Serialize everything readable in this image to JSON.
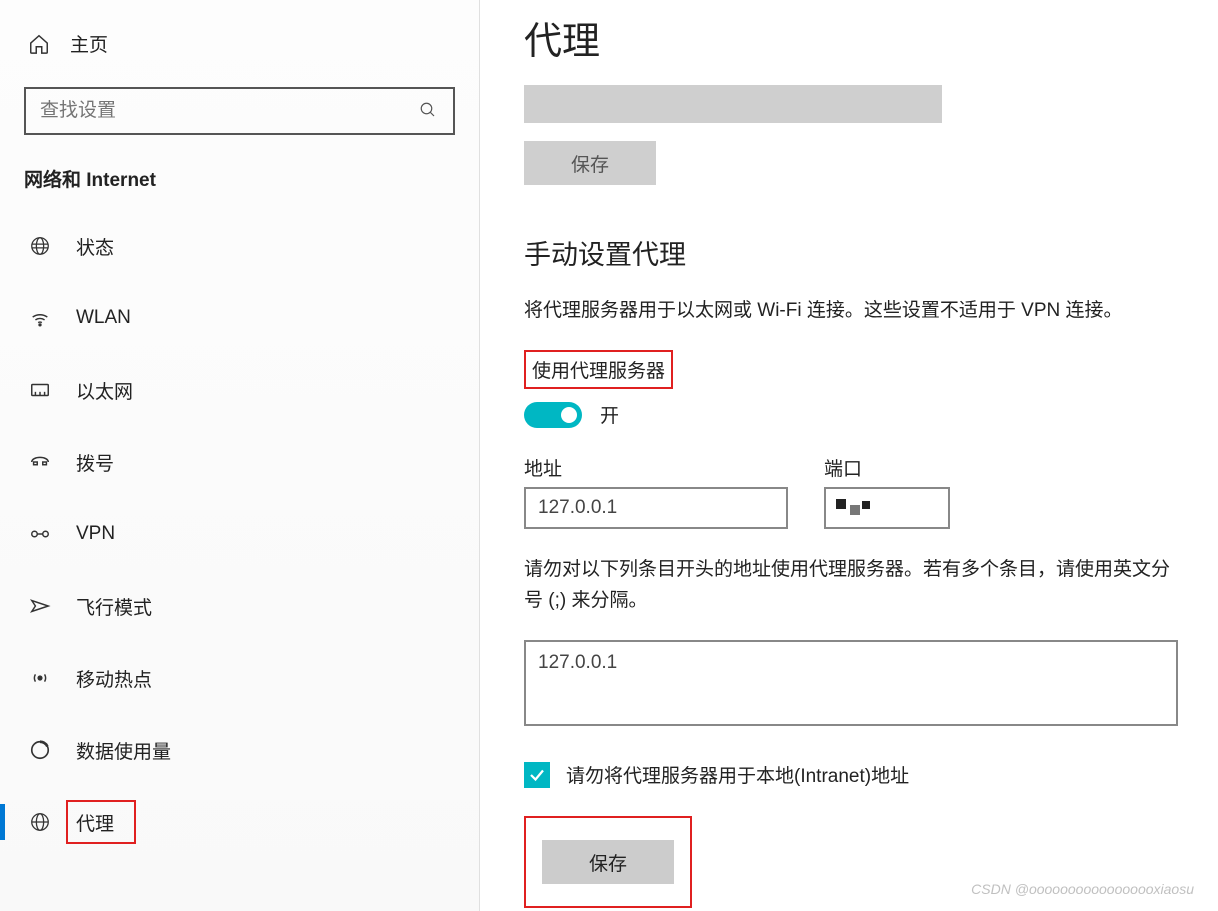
{
  "sidebar": {
    "home_label": "主页",
    "search_placeholder": "查找设置",
    "section_title": "网络和 Internet",
    "items": [
      {
        "label": "状态"
      },
      {
        "label": "WLAN"
      },
      {
        "label": "以太网"
      },
      {
        "label": "拨号"
      },
      {
        "label": "VPN"
      },
      {
        "label": "飞行模式"
      },
      {
        "label": "移动热点"
      },
      {
        "label": "数据使用量"
      },
      {
        "label": "代理"
      }
    ]
  },
  "main": {
    "page_title": "代理",
    "save_btn_top": "保存",
    "manual_heading": "手动设置代理",
    "manual_description": "将代理服务器用于以太网或 Wi-Fi 连接。这些设置不适用于 VPN 连接。",
    "use_proxy_label": "使用代理服务器",
    "toggle_state": "开",
    "address_label": "地址",
    "address_value": "127.0.0.1",
    "port_label": "端口",
    "exclude_description": "请勿对以下列条目开头的地址使用代理服务器。若有多个条目，请使用英文分号 (;) 来分隔。",
    "exclude_value": "127.0.0.1",
    "intranet_checkbox_label": "请勿将代理服务器用于本地(Intranet)地址",
    "save_btn_bottom": "保存"
  },
  "watermark": "CSDN @ooooooooooooooooxiaosu"
}
